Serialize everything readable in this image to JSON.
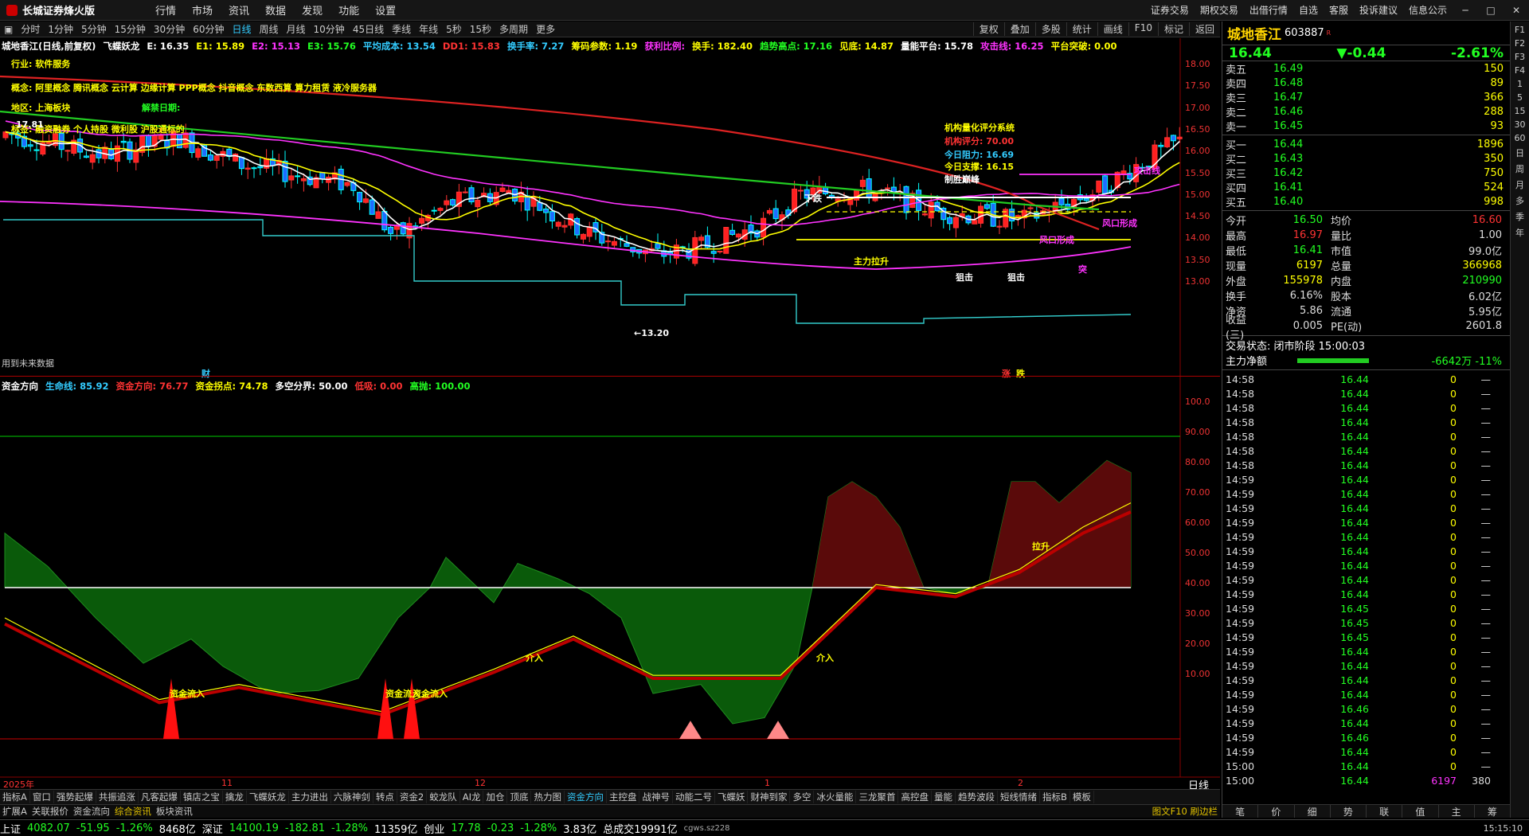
{
  "app": {
    "title": "长城证券烽火版",
    "menu": [
      "行情",
      "市场",
      "资讯",
      "数据",
      "发现",
      "功能",
      "设置"
    ],
    "right_menu": [
      "证券交易",
      "期权交易",
      "出借行情",
      "自选",
      "客服",
      "投诉建议",
      "信息公示"
    ]
  },
  "toolbar": {
    "periods": [
      "分时",
      "1分钟",
      "5分钟",
      "15分钟",
      "30分钟",
      "60分钟",
      "日线",
      "周线",
      "月线",
      "10分钟",
      "45日线",
      "季线",
      "年线",
      "5秒",
      "15秒",
      "多周期",
      "更多"
    ],
    "active": "日线",
    "right": [
      "复权",
      "叠加",
      "多股",
      "统计",
      "画线",
      "F10",
      "标记",
      "返回"
    ]
  },
  "main_info": {
    "stock": "城地香江(日线,前复权)",
    "indicator": "飞蝶妖龙",
    "E": "E: 16.35",
    "E1": "E1: 15.89",
    "E2": "E2: 15.13",
    "E3": "E3: 15.76",
    "avgcost": "平均成本: 13.54",
    "dd1": "DD1: 15.83",
    "turnover": "换手率: 7.27",
    "chip": "筹码参数: 1.19",
    "profit": "获利比例:",
    "hand": "换手: 182.40",
    "trend": "趋势高点: 17.16",
    "view": "见底: 14.87",
    "line": "量能平台: 15.78",
    "attack": "攻击线: 16.25",
    "platform": "平台突破: 0.00"
  },
  "overlays": {
    "industry": "行业: 软件服务",
    "concept": "概念: 阿里概念 腾讯概念 云计算 边缘计算 PPP概念 抖音概念 东数西算 算力租赁 液冷服务器",
    "region": "地区: 上海板块",
    "unlock": "解禁日期:",
    "finance": "标签: 融资融券 个人持股 微利股 沪股通标的",
    "future": "用到未来数据",
    "marker_cai": "财",
    "marker_zhang": "涨",
    "marker_jie": "跌",
    "low_label": "←13.20",
    "high_label": "17.81",
    "xiadie": "下跌",
    "jigou_title": "机构量化评分系统",
    "jigou_score": "机构评分: 70.00",
    "today_res": "今日阻力: 16.69",
    "today_sup": "今日支撑: 16.15",
    "zhisheng": "制胜巅峰",
    "gongji": "攻击线",
    "fengkou": "风口形成",
    "fengkou2": "风口形成",
    "tu": "突",
    "zhuli": "主力拉升",
    "jiji": "狙击",
    "jiji2": "狙击"
  },
  "price_axis": [
    "18.00",
    "17.50",
    "17.00",
    "16.50",
    "16.00",
    "15.50",
    "15.00",
    "14.50",
    "14.00",
    "13.50",
    "13.00"
  ],
  "sub_info": {
    "name": "资金方向",
    "life": "生命线: 85.92",
    "dir": "资金方向: 76.77",
    "turn": "资金拐点: 74.78",
    "split": "多空分界: 50.00",
    "low": "低吸: 0.00",
    "high": "高抛: 100.00"
  },
  "sub_axis": [
    "100.0",
    "90.00",
    "80.00",
    "70.00",
    "60.00",
    "50.00",
    "40.00",
    "30.00",
    "20.00",
    "10.00"
  ],
  "sub_labels": {
    "in1": "资金流入",
    "in2": "资金流入",
    "in3": "资金流入",
    "jie1": "介入",
    "jie2": "介入",
    "jie3": "拉升"
  },
  "date_axis": [
    "2025年",
    "11",
    "12",
    "1",
    "2"
  ],
  "date_mode": "日线",
  "bottom_tabs": [
    "指标A",
    "窗口",
    "强势起爆",
    "共振追涨",
    "凡客起爆",
    "镇店之宝",
    "擒龙",
    "飞蝶妖龙",
    "主力进出",
    "六脉神剑",
    "转点",
    "资金2",
    "蛟龙队",
    "AI龙",
    "加仓",
    "顶底",
    "热力图",
    "资金方向",
    "主控盘",
    "战神号",
    "动能二号",
    "飞蝶妖",
    "财神到家",
    "多空",
    "冰火量能",
    "三龙聚首",
    "高控盘",
    "量能",
    "趋势波段",
    "短线情绪",
    "指标B",
    "模板"
  ],
  "bottom_active": "资金方向",
  "bottom_tabs2": [
    "扩展A",
    "关联报价",
    "资金流向",
    "综合资讯",
    "板块资讯"
  ],
  "bottom_active2": "综合资讯",
  "bottom_f10": "图文F10 刷边栏",
  "quote": {
    "name": "城地香江",
    "code": "603887",
    "price": "16.44",
    "change": "▼-0.44",
    "pct": "-2.61%",
    "asks": [
      [
        "卖五",
        "16.49",
        "150"
      ],
      [
        "卖四",
        "16.48",
        "89"
      ],
      [
        "卖三",
        "16.47",
        "366"
      ],
      [
        "卖二",
        "16.46",
        "288"
      ],
      [
        "卖一",
        "16.45",
        "93"
      ]
    ],
    "bids": [
      [
        "买一",
        "16.44",
        "1896"
      ],
      [
        "买二",
        "16.43",
        "350"
      ],
      [
        "买三",
        "16.42",
        "750"
      ],
      [
        "买四",
        "16.41",
        "524"
      ],
      [
        "买五",
        "16.40",
        "998"
      ]
    ],
    "stats": [
      [
        "今开",
        "16.50",
        "均价",
        "16.60"
      ],
      [
        "最高",
        "16.97",
        "量比",
        "1.00"
      ],
      [
        "最低",
        "16.41",
        "市值",
        "99.0亿"
      ],
      [
        "现量",
        "6197",
        "总量",
        "366968"
      ],
      [
        "外盘",
        "155978",
        "内盘",
        "210990"
      ],
      [
        "换手",
        "6.16%",
        "股本",
        "6.02亿"
      ],
      [
        "净资",
        "5.86",
        "流通",
        "5.95亿"
      ],
      [
        "收益(三)",
        "0.005",
        "PE(动)",
        "2601.8"
      ]
    ],
    "status": "交易状态: 闭市阶段 15:00:03",
    "netflow_label": "主力净额",
    "netflow": "-6642万 -11%",
    "ticks": [
      [
        "14:58",
        "16.44",
        "0",
        "—"
      ],
      [
        "14:58",
        "16.44",
        "0",
        "—"
      ],
      [
        "14:58",
        "16.44",
        "0",
        "—"
      ],
      [
        "14:58",
        "16.44",
        "0",
        "—"
      ],
      [
        "14:58",
        "16.44",
        "0",
        "—"
      ],
      [
        "14:58",
        "16.44",
        "0",
        "—"
      ],
      [
        "14:58",
        "16.44",
        "0",
        "—"
      ],
      [
        "14:59",
        "16.44",
        "0",
        "—"
      ],
      [
        "14:59",
        "16.44",
        "0",
        "—"
      ],
      [
        "14:59",
        "16.44",
        "0",
        "—"
      ],
      [
        "14:59",
        "16.44",
        "0",
        "—"
      ],
      [
        "14:59",
        "16.44",
        "0",
        "—"
      ],
      [
        "14:59",
        "16.44",
        "0",
        "—"
      ],
      [
        "14:59",
        "16.44",
        "0",
        "—"
      ],
      [
        "14:59",
        "16.44",
        "0",
        "—"
      ],
      [
        "14:59",
        "16.44",
        "0",
        "—"
      ],
      [
        "14:59",
        "16.45",
        "0",
        "—"
      ],
      [
        "14:59",
        "16.45",
        "0",
        "—"
      ],
      [
        "14:59",
        "16.45",
        "0",
        "—"
      ],
      [
        "14:59",
        "16.44",
        "0",
        "—"
      ],
      [
        "14:59",
        "16.44",
        "0",
        "—"
      ],
      [
        "14:59",
        "16.44",
        "0",
        "—"
      ],
      [
        "14:59",
        "16.44",
        "0",
        "—"
      ],
      [
        "14:59",
        "16.46",
        "0",
        "—"
      ],
      [
        "14:59",
        "16.44",
        "0",
        "—"
      ],
      [
        "14:59",
        "16.46",
        "0",
        "—"
      ],
      [
        "14:59",
        "16.44",
        "0",
        "—"
      ],
      [
        "15:00",
        "16.44",
        "0",
        "—"
      ],
      [
        "15:00",
        "16.44",
        "6197",
        "380"
      ]
    ],
    "tabs": [
      "笔",
      "价",
      "细",
      "势",
      "联",
      "值",
      "主",
      "筹"
    ]
  },
  "statusbar": {
    "sh_label": "上证",
    "sh": "4082.07",
    "sh_chg": "-51.95",
    "sh_pct": "-1.26%",
    "sh_amt": "8468亿",
    "sz_label": "深证",
    "sz": "14100.19",
    "sz_chg": "-182.81",
    "sz_pct": "-1.28%",
    "sz_amt": "11359亿",
    "cy_label": "创业",
    "cy": "17.78",
    "cy_chg": "-0.23",
    "cy_pct": "-1.28%",
    "cy_amt": "3.83亿",
    "total": "总成交19991亿",
    "server": "cgws.sz228",
    "time": "15:15:10"
  },
  "vtool": [
    "F1",
    "F2",
    "F3",
    "F4",
    "1",
    "5",
    "15",
    "30",
    "60",
    "日",
    "周",
    "月",
    "多",
    "季",
    "年"
  ],
  "colors": {
    "up": "#ff3333",
    "down": "#00ffff",
    "ma_white": "#ffffff",
    "ma_yellow": "#ffff00",
    "ma_magenta": "#ff33ff",
    "ma_red": "#dd2222",
    "ma_green": "#22cc22",
    "fund_green": "#0a5a0a",
    "fund_red": "#5a0a0a"
  }
}
